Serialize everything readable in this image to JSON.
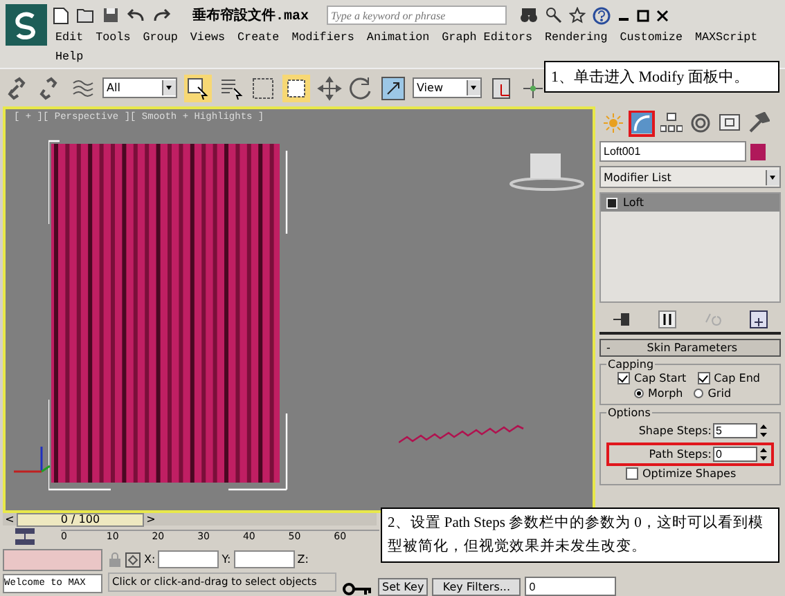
{
  "title_bar": {
    "file_name": "垂布帘設文件.max",
    "search": {
      "placeholder": "Type a keyword or phrase"
    }
  },
  "menu": [
    "Edit",
    "Tools",
    "Group",
    "Views",
    "Create",
    "Modifiers",
    "Animation",
    "Graph Editors",
    "Rendering",
    "Customize",
    "MAXScript",
    "Help"
  ],
  "toolbar": {
    "selection_filter": "All",
    "reference_coordinate": "View"
  },
  "viewport": {
    "label": "[ + ][ Perspective ][ Smooth + Highlights ]"
  },
  "command_panel": {
    "tabs": [
      {
        "kind": "create",
        "selected": false
      },
      {
        "kind": "modify",
        "selected": true
      },
      {
        "kind": "hierarchy",
        "selected": false
      },
      {
        "kind": "motion",
        "selected": false
      },
      {
        "kind": "display",
        "selected": false
      },
      {
        "kind": "utilities",
        "selected": false
      }
    ],
    "object_name": "Loft001",
    "modifier_list": "Modifier List",
    "stack": [
      {
        "label": "Loft",
        "selected": true
      }
    ],
    "rollout": {
      "title": "Skin Parameters",
      "collapse": "-",
      "capping": {
        "title": "Capping",
        "checkboxes": [
          {
            "label": "Cap Start",
            "checked": true
          },
          {
            "label": "Cap End",
            "checked": true
          }
        ],
        "radios": [
          {
            "label": "Morph",
            "selected": true
          },
          {
            "label": "Grid",
            "selected": false
          }
        ]
      },
      "options": {
        "title": "Options",
        "spinners": [
          {
            "label": "Shape Steps:",
            "value": "5",
            "highlighted": false
          },
          {
            "label": "Path Steps:",
            "value": "0",
            "highlighted": true
          }
        ],
        "checkboxes": [
          {
            "label": "Optimize Shapes",
            "checked": false
          }
        ]
      }
    }
  },
  "time_slider": {
    "label": "0 / 100",
    "level": 0,
    "prev": "<",
    "next": ">"
  },
  "track_bar": {
    "ticks": [
      "0",
      "10",
      "20",
      "30",
      "40",
      "50",
      "60"
    ]
  },
  "status_bar": {
    "script_output": "Welcome to MAX",
    "prompt": "Click or click-and-drag to select objects",
    "x_label": "X:",
    "y_label": "Y:",
    "z_label": "Z:",
    "set_key": "Set Key",
    "key_filters": "Key Filters...",
    "frame": "0"
  },
  "callouts": [
    {
      "text": "1、单击进入 Modify 面板中。"
    },
    {
      "text": "2、设置 Path Steps 参数栏中的参数为 0，这时可以看到模型被简化，但视觉效果并未发生改变。"
    }
  ]
}
